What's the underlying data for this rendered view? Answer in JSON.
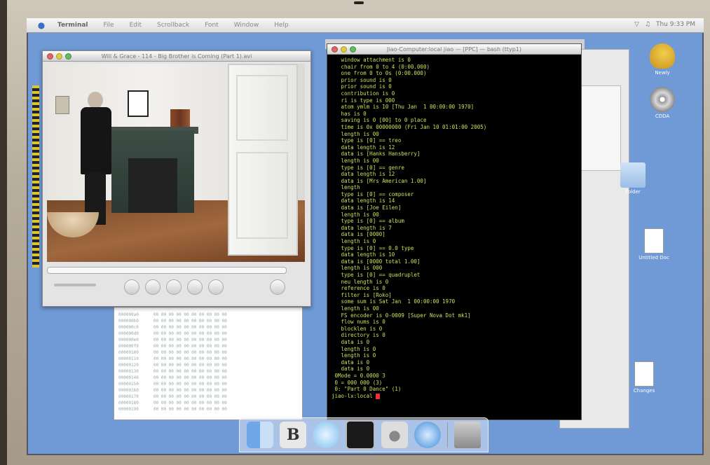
{
  "menubar": {
    "app_name": "Terminal",
    "items": [
      "File",
      "Edit",
      "Scrollback",
      "Font",
      "Window",
      "Help"
    ],
    "clock": "Thu 9:33 PM"
  },
  "video_window": {
    "title": "Will & Grace - 114 - Big Brother is Coming (Part 1).avi"
  },
  "terminal_window": {
    "title": "Jiao-Computer:local jiao — [PPC] — bash (ttyp1)",
    "lines": [
      "   window attachment is 0",
      "   chair from 0 to 4 (0:00.000)",
      "   one from 0 to 0s (0:00.000)",
      "   prior sound is 0",
      "   prior sound is 0",
      "   contribution is 0",
      "   ri is type is 000",
      "   atom ymlm is 10 [Thu Jan  1 00:00:00 1970]",
      "   has is 0",
      "   saving is 0 [00] to 0 place",
      "   time is 0x 00000000 (Fri Jan 10 01:01:00 2005)",
      "   length is 00",
      "   type is [0] == treo",
      "   data length is 12",
      "   data is [Hanks Hansberry]",
      "   length is 00",
      "   type is [0] == genre",
      "   data length is 12",
      "   data is [Mrs American 1.00]",
      "   length",
      "   type is [0] == composer",
      "   data length is 14",
      "   data is [Joe Eilen]",
      "   length is 00",
      "   type is [0] == album",
      "   data length is 7",
      "   data is [0000]",
      "   length is 0",
      "   type is [0] == 0.0 type",
      "   data length is 10",
      "   data is [0000 total 1.00]",
      "   length is 000",
      "   type is [0] == quadruplet",
      "   neu length is 0",
      "   reference is 0",
      "   filter is [Roko]",
      "   some sum is Sat Jan  1 00:00:00 1970",
      "   length is 00",
      "   FS encoder is 0-0009 [Super Nova Dot mk1]",
      "   flow nums is 0",
      "   blocklen is 0",
      "   directory is 0",
      "   data is 0",
      "   length is 0",
      "   length is 0",
      "   data is 0",
      "   data is 0",
      " 0Mode = 0.0000 3",
      " 0 = 000 000 (3)",
      " 0: \"Part 0 Dance\" (1)",
      "",
      "jiao-lx:local "
    ]
  },
  "hex_window": {
    "offsets": [
      "000000a0",
      "000000b0",
      "000000c0",
      "000000d0",
      "000000e0",
      "000000f0",
      "00000100",
      "00000110",
      "00000120",
      "00000130",
      "00000140",
      "00000150",
      "00000160",
      "00000170",
      "00000180",
      "00000190"
    ]
  },
  "desktop_icons": [
    {
      "label": "Newly",
      "icon": "duck-icon"
    },
    {
      "label": "CDDA",
      "icon": "disc-icon"
    },
    {
      "label": "Folder",
      "icon": "folder-icon"
    },
    {
      "label": "Untitled Doc",
      "icon": "document-icon"
    },
    {
      "label": "Changes",
      "icon": "document-icon"
    }
  ],
  "dock": [
    "finder-icon",
    "bbedit-icon",
    "itunes-icon",
    "terminal-icon",
    "apple-icon",
    "safari-icon",
    "trash-icon"
  ],
  "colors": {
    "desktop": "#6f9ad6",
    "terminal_text": "#c9e05a",
    "terminal_bg": "#000000",
    "cursor": "#e33333"
  }
}
